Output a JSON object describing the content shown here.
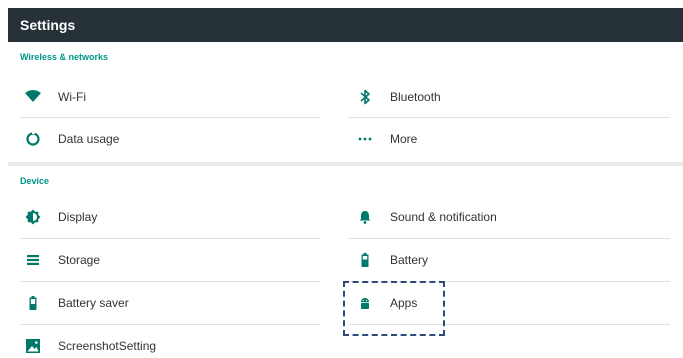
{
  "appbar": {
    "title": "Settings"
  },
  "sections": {
    "wireless": {
      "title": "Wireless & networks",
      "items": [
        {
          "label": "Wi-Fi",
          "icon": "wifi-icon"
        },
        {
          "label": "Bluetooth",
          "icon": "bluetooth-icon"
        },
        {
          "label": "Data usage",
          "icon": "data-usage-icon"
        },
        {
          "label": "More",
          "icon": "more-dots-icon"
        }
      ]
    },
    "device": {
      "title": "Device",
      "items": [
        {
          "label": "Display",
          "icon": "brightness-icon"
        },
        {
          "label": "Sound & notification",
          "icon": "bell-icon"
        },
        {
          "label": "Storage",
          "icon": "storage-icon"
        },
        {
          "label": "Battery",
          "icon": "battery-icon"
        },
        {
          "label": "Battery saver",
          "icon": "battery-saver-icon"
        },
        {
          "label": "Apps",
          "icon": "android-icon"
        },
        {
          "label": "ScreenshotSetting",
          "icon": "screenshot-icon"
        }
      ]
    }
  },
  "colors": {
    "appbar": "#263238",
    "accent": "#009688",
    "icon": "#00796b",
    "highlight": "#2c4a7a"
  }
}
